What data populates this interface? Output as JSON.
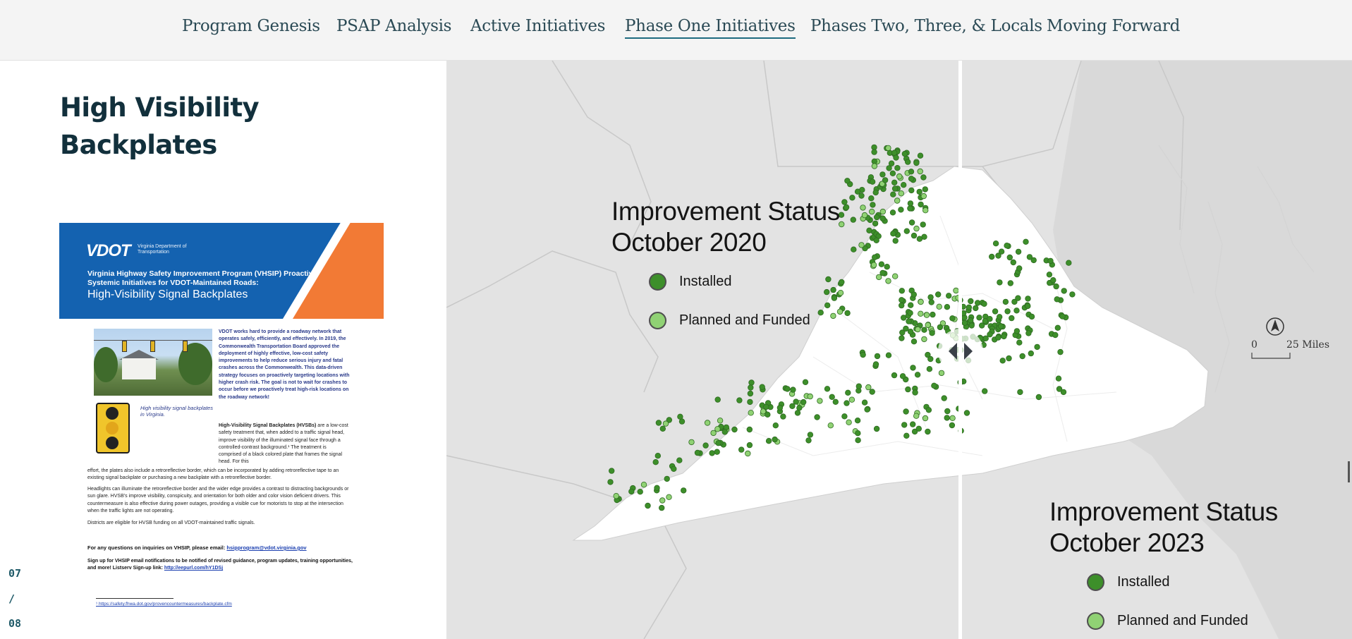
{
  "nav": {
    "items": [
      {
        "label": "Program Genesis"
      },
      {
        "label": "PSAP Analysis"
      },
      {
        "label": "Active Initiatives"
      },
      {
        "label": "Phase One Initiatives",
        "active": true
      },
      {
        "label": "Phases Two, Three, & Locals"
      },
      {
        "label": "Moving Forward"
      }
    ]
  },
  "left": {
    "title": "High Visibility Backplates",
    "pager": {
      "current": "07",
      "separator": "/",
      "total": "08"
    }
  },
  "document": {
    "logo": "VDOT",
    "dept": "Virginia Department of Transportation",
    "heading": "Virginia Highway Safety Improvement Program (VHSIP) Proactive Systemic Initiatives for VDOT-Maintained Roads:",
    "subheading": "High-Visibility Signal Backplates",
    "caption": "High visibility signal backplates in Virginia.",
    "intro": "VDOT works hard to provide a roadway network that operates safely, efficiently, and effectively. In 2019, the Commonwealth Transportation Board approved the deployment of highly effective, low-cost safety improvements to help reduce serious injury and fatal crashes across the Commonwealth. This data-driven strategy focuses on proactively targeting locations with higher crash risk. The goal is not to wait for crashes to occur before we proactively treat high-risk locations on the roadway network!",
    "body_lead": "High-Visibility Signal Backplates (HVSBs)",
    "body1": " are a low-cost safety treatment that, when added to a traffic signal head, improve visibility of the illuminated signal face through a controlled-contrast background.¹ The treatment is comprised of a black colored plate that frames the signal head. For this",
    "body2": "effort, the plates also include a retroreflective border, which can be incorporated by adding retroreflective tape to an existing signal backplate or purchasing a new backplate with a retroreflective border.",
    "body3": "Headlights can illuminate the retroreflective border and the wider edge provides a contrast to distracting backgrounds or sun glare. HVSB's improve visibility, conspicuity, and orientation for both older and color vision deficient drivers. This countermeasure is also effective during power outages, providing a visible cue for motorists to stop at the intersection when the traffic lights are not operating.",
    "body4": "Districts are eligible for HVSB funding on all VDOT-maintained traffic signals.",
    "contact_text": "For any questions on inquiries on VHSIP, please email: ",
    "contact_email": "hsipprogram@vdot.virginia.gov",
    "signup_text": "Sign up for VHSIP email notifications to be notified of revised guidance, program updates, training opportunities, and more! Listserv Sign-up link: ",
    "signup_link": "http://eepurl.com/hY1DSj",
    "footnote": "¹ https://safety.fhwa.dot.gov/provencountermeasures/backplate.cfm"
  },
  "map": {
    "legend_before": {
      "title_line1": "Improvement Status",
      "title_line2": "October 2020",
      "installed": "Installed",
      "planned": "Planned and Funded"
    },
    "legend_after": {
      "title_line1": "Improvement Status",
      "title_line2": "October 2023",
      "installed": "Installed",
      "planned": "Planned and Funded"
    },
    "scale": {
      "zero": "0",
      "distance": "25 Miles"
    },
    "colors": {
      "installed": "#3d8f2a",
      "planned": "#90d274",
      "state_fill": "#ffffff",
      "background": "#e3e3e3"
    },
    "icons": {
      "north": "north-arrow-icon",
      "swipe": "swipe-handle-icon"
    }
  }
}
